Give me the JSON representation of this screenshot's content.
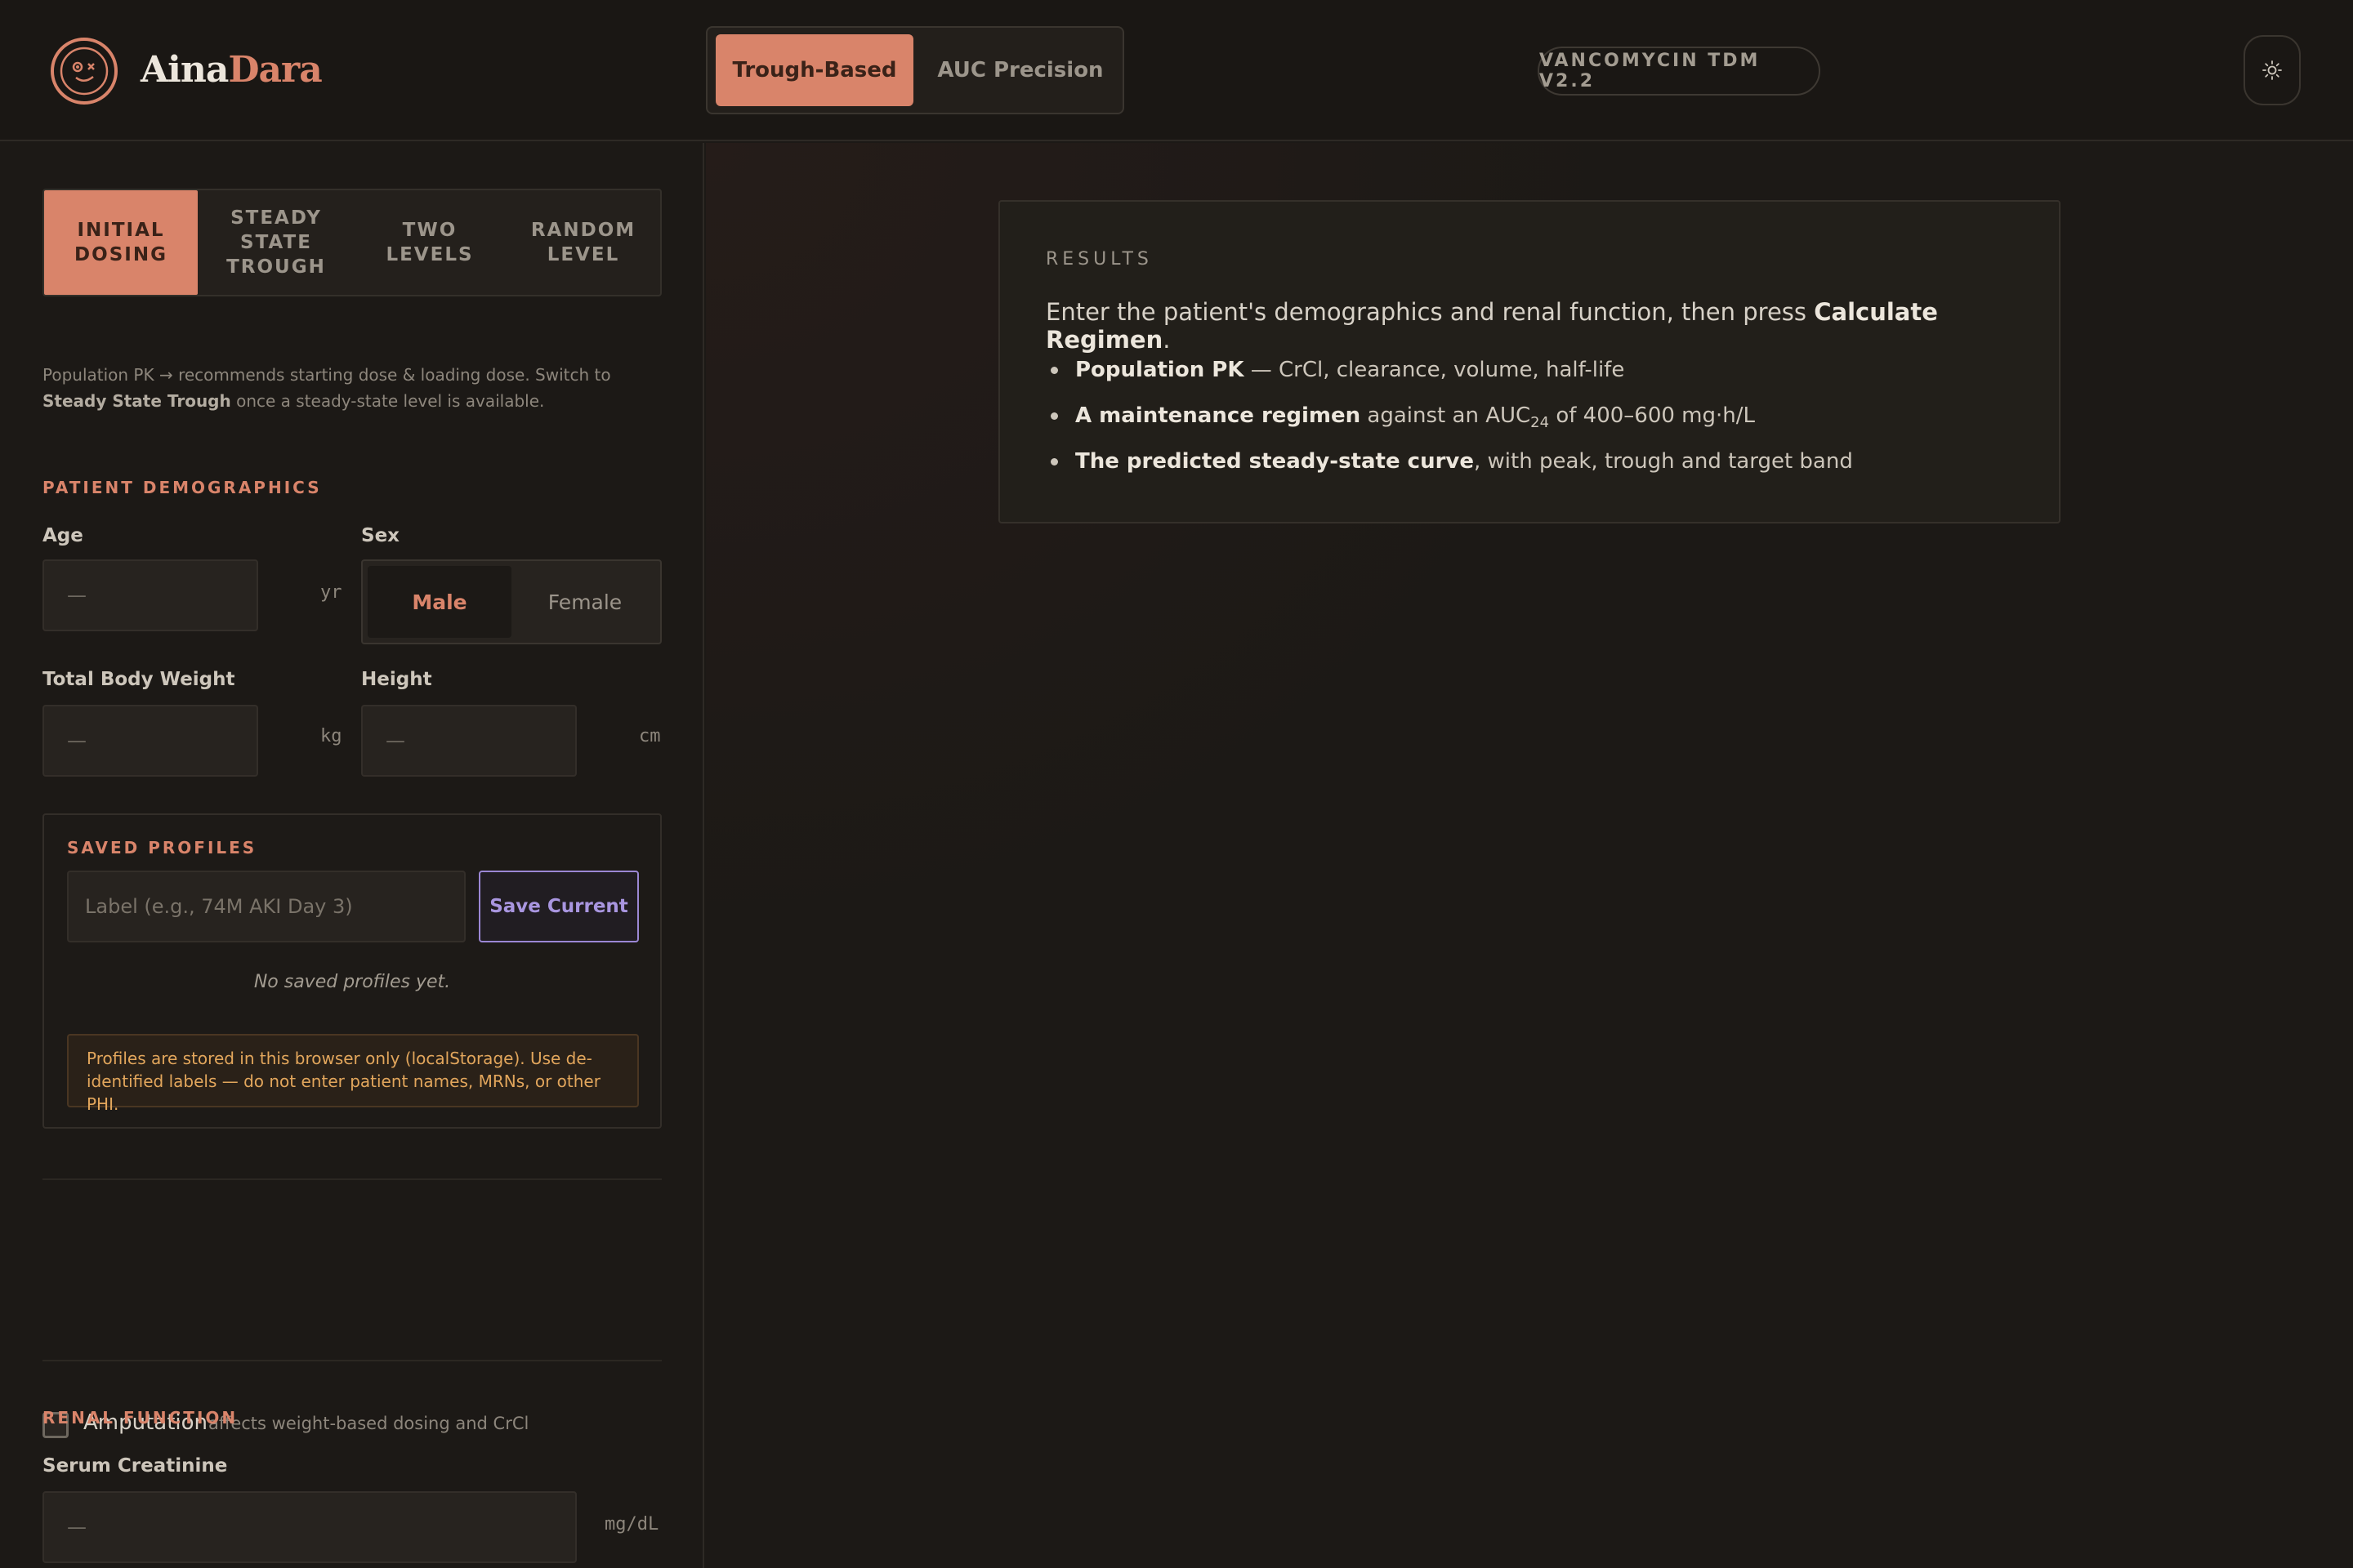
{
  "brand": {
    "name_part1": "Aina",
    "name_part2": "Dara"
  },
  "mode_switch": {
    "active": "Trough-Based",
    "inactive": "AUC Precision"
  },
  "version": "VANCOMYCIN TDM V2.2",
  "theme_toggle": {
    "icon": "sun-icon"
  },
  "subtabs": [
    {
      "label": "INITIAL\nDOSING",
      "active": true
    },
    {
      "label": "STEADY\nSTATE\nTROUGH",
      "active": false
    },
    {
      "label": "TWO\nLEVELS",
      "active": false
    },
    {
      "label": "RANDOM\nLEVEL",
      "active": false
    }
  ],
  "hint": {
    "prefix": "Population PK → recommends starting dose & loading dose. Switch to ",
    "emphasis": "Steady State Trough",
    "suffix": " once a steady-state level is available."
  },
  "demographics": {
    "section": "PATIENT DEMOGRAPHICS",
    "age": {
      "label": "Age",
      "placeholder": "—",
      "unit": "yr"
    },
    "sex": {
      "label": "Sex",
      "options": [
        "Male",
        "Female"
      ],
      "selected": "Male"
    },
    "weight": {
      "label": "Total Body Weight",
      "placeholder": "—",
      "unit": "kg"
    },
    "height": {
      "label": "Height",
      "placeholder": "—",
      "unit": "cm"
    }
  },
  "saved_profiles": {
    "section": "SAVED PROFILES",
    "input_placeholder": "Label (e.g., 74M AKI Day 3)",
    "save_label": "Save Current",
    "empty_text": "No saved profiles yet.",
    "warning": "Profiles are stored in this browser only (localStorage). Use de-identified labels — do not enter patient names, MRNs, or other PHI."
  },
  "amputation": {
    "label": "Amputation",
    "hint": "affects weight-based dosing and CrCl",
    "checked": false
  },
  "renal": {
    "section": "RENAL FUNCTION",
    "scr": {
      "label": "Serum Creatinine",
      "placeholder": "—",
      "unit": "mg/dL"
    }
  },
  "results": {
    "title": "RESULTS",
    "intro_prefix": "Enter the patient's demographics and renal function, then press ",
    "intro_emphasis": "Calculate Regimen",
    "intro_suffix": ".",
    "items": [
      {
        "bold": "Population PK",
        "rest": " — CrCl, clearance, volume, half-life"
      },
      {
        "bold": "A maintenance regimen",
        "rest_pre": " against an AUC",
        "sub": "24",
        "rest_post": " of 400–600 mg·h/L"
      },
      {
        "bold": "The predicted steady-state curve",
        "rest": ", with peak, trough and target band"
      }
    ]
  },
  "colors": {
    "accent": "#d9846a",
    "purple": "#9b87d4",
    "warning": "#e2a65c",
    "background": "#1c1916"
  }
}
